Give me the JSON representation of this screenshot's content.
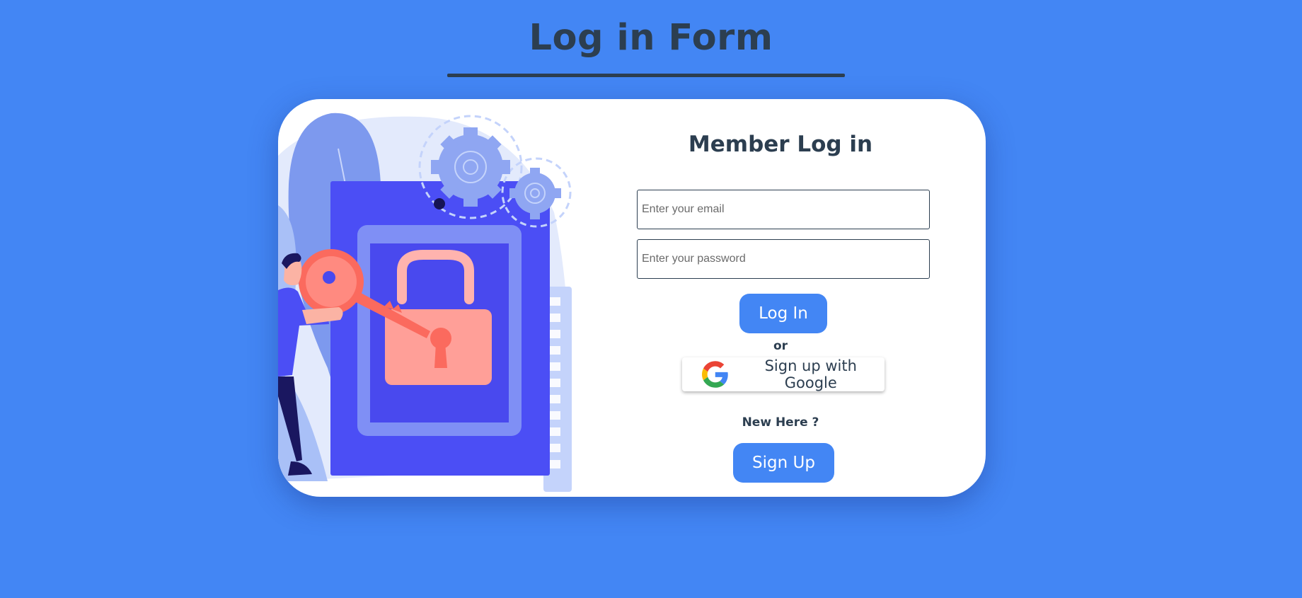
{
  "page": {
    "title": "Log in Form"
  },
  "form": {
    "heading": "Member Log in",
    "email_placeholder": "Enter your email",
    "password_placeholder": "Enter your password",
    "login_label": "Log In",
    "or_text": "or",
    "google_label": "Sign up with Google",
    "new_here": "New Here ?",
    "signup_label": "Sign Up"
  },
  "colors": {
    "background": "#4386f4",
    "text": "#2c3e50",
    "button": "#4386f4",
    "card": "#ffffff"
  },
  "icons": {
    "google": "google-g-logo",
    "illustration": "unlock-with-key-illustration"
  }
}
